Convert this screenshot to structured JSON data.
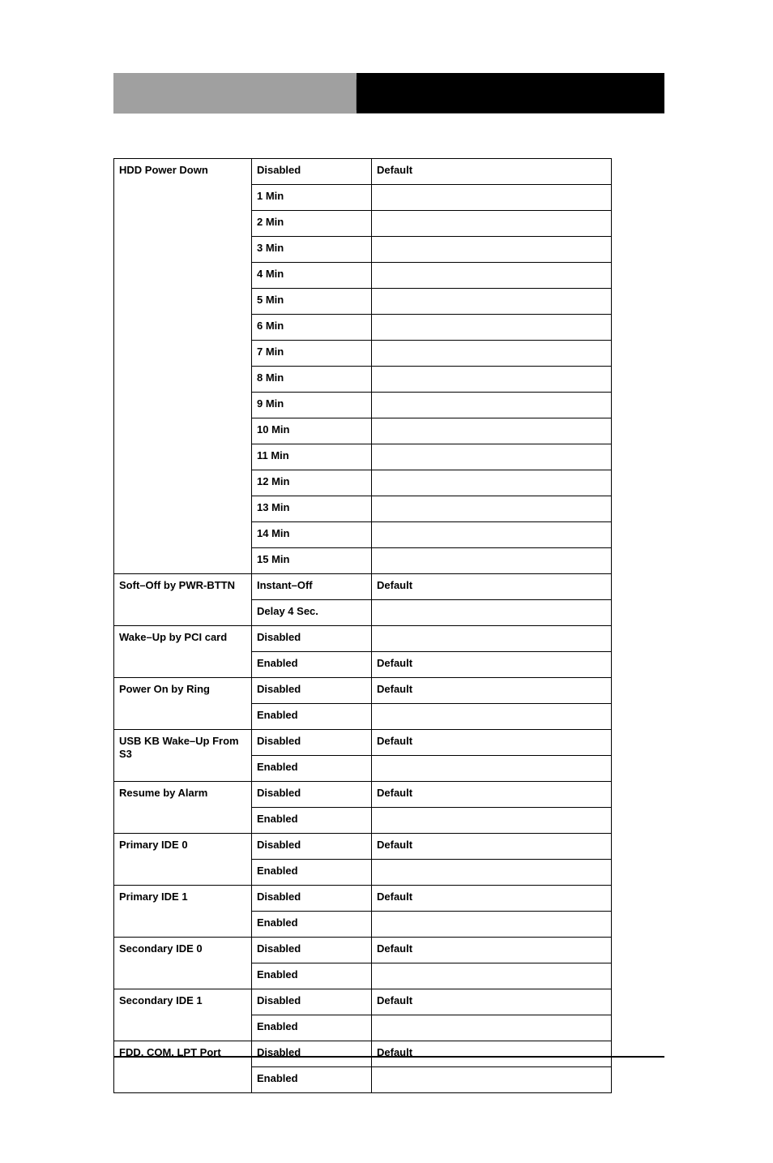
{
  "groups": [
    {
      "setting": "HDD Power Down",
      "rows": [
        {
          "option": "Disabled",
          "note": "Default"
        },
        {
          "option": "1 Min",
          "note": ""
        },
        {
          "option": "2 Min",
          "note": ""
        },
        {
          "option": "3 Min",
          "note": ""
        },
        {
          "option": "4 Min",
          "note": ""
        },
        {
          "option": "5 Min",
          "note": ""
        },
        {
          "option": "6 Min",
          "note": ""
        },
        {
          "option": "7 Min",
          "note": ""
        },
        {
          "option": "8 Min",
          "note": ""
        },
        {
          "option": "9 Min",
          "note": ""
        },
        {
          "option": "10 Min",
          "note": ""
        },
        {
          "option": "11 Min",
          "note": ""
        },
        {
          "option": "12 Min",
          "note": ""
        },
        {
          "option": "13 Min",
          "note": ""
        },
        {
          "option": "14 Min",
          "note": ""
        },
        {
          "option": "15 Min",
          "note": ""
        }
      ]
    },
    {
      "setting": "Soft–Off by PWR-BTTN",
      "rows": [
        {
          "option": "Instant–Off",
          "note": "Default"
        },
        {
          "option": "Delay 4 Sec.",
          "note": ""
        }
      ]
    },
    {
      "setting": "Wake–Up by PCI card",
      "rows": [
        {
          "option": "Disabled",
          "note": ""
        },
        {
          "option": "Enabled",
          "note": "Default"
        }
      ]
    },
    {
      "setting": "Power On by Ring",
      "rows": [
        {
          "option": "Disabled",
          "note": "Default"
        },
        {
          "option": "Enabled",
          "note": ""
        }
      ]
    },
    {
      "setting": "USB KB Wake–Up From S3",
      "rows": [
        {
          "option": "Disabled",
          "note": "Default"
        },
        {
          "option": "Enabled",
          "note": ""
        }
      ]
    },
    {
      "setting": "Resume by Alarm",
      "rows": [
        {
          "option": "Disabled",
          "note": "Default"
        },
        {
          "option": "Enabled",
          "note": ""
        }
      ]
    },
    {
      "setting": "Primary IDE 0",
      "rows": [
        {
          "option": "Disabled",
          "note": "Default"
        },
        {
          "option": "Enabled",
          "note": ""
        }
      ]
    },
    {
      "setting": "Primary IDE 1",
      "rows": [
        {
          "option": "Disabled",
          "note": "Default"
        },
        {
          "option": "Enabled",
          "note": ""
        }
      ]
    },
    {
      "setting": "Secondary IDE 0",
      "rows": [
        {
          "option": "Disabled",
          "note": "Default"
        },
        {
          "option": "Enabled",
          "note": ""
        }
      ]
    },
    {
      "setting": "Secondary IDE 1",
      "rows": [
        {
          "option": "Disabled",
          "note": "Default"
        },
        {
          "option": "Enabled",
          "note": ""
        }
      ]
    },
    {
      "setting": "FDD, COM, LPT Port",
      "rows": [
        {
          "option": "Disabled",
          "note": "Default"
        },
        {
          "option": "Enabled",
          "note": ""
        }
      ]
    }
  ]
}
